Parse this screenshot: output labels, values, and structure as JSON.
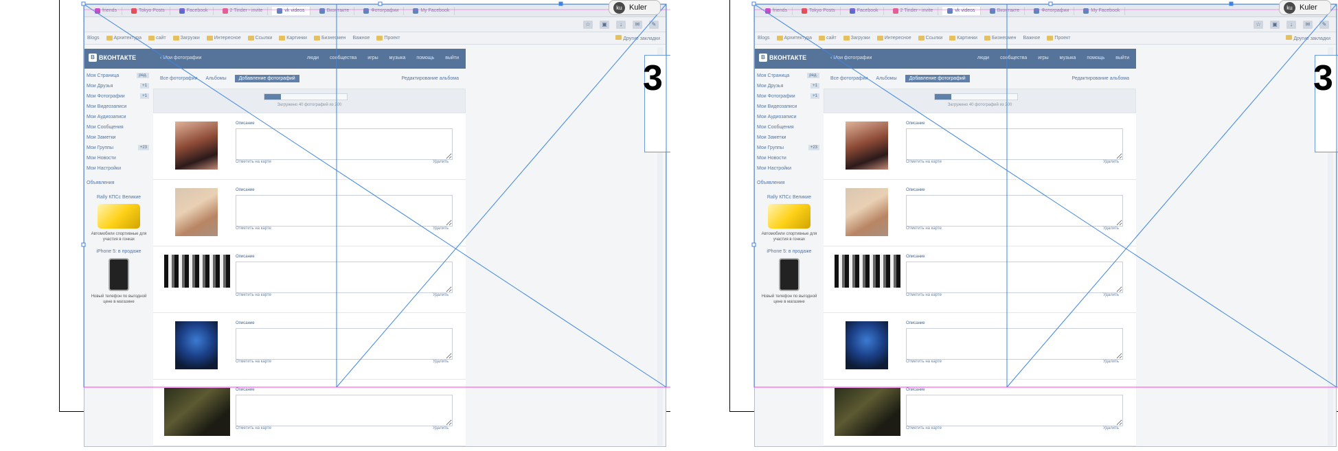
{
  "kuler": {
    "icon": "ku",
    "label": "Kuler"
  },
  "big_number": "3",
  "colors": {
    "vk_blue": "#56739a",
    "guide_blue": "#3d85e0",
    "guide_pink": "#ff3cf0"
  },
  "tabs": [
    {
      "label": "friends",
      "color": "#c44dc4"
    },
    {
      "label": "Tokyo Posts",
      "color": "#e05050"
    },
    {
      "label": "Facebook",
      "color": "#5b6cc8"
    },
    {
      "label": "2 Tinder - invite",
      "color": "#e06090"
    },
    {
      "label": "vk videos",
      "color": "#5a86bd",
      "active": true
    },
    {
      "label": "Вконтакте",
      "color": "#5a86bd"
    },
    {
      "label": "Фотографии",
      "color": "#5a86bd"
    },
    {
      "label": "My Facebook",
      "color": "#5a86bd"
    }
  ],
  "bookmarks": [
    "Blogs",
    "Архитектура",
    "сайт",
    "Загрузки",
    "Интересное",
    "Ссылки",
    "Картинки",
    "Бизнесмен",
    "Важное",
    "Проект"
  ],
  "bookmarks_right": "Другие закладки",
  "vk": {
    "logo_icon": "В",
    "logo": "ВКОНТАКТЕ",
    "crumb": "‹ Мои фотографии",
    "nav": [
      "люди",
      "сообщества",
      "игры",
      "музыка",
      "помощь",
      "выйти"
    ]
  },
  "sidebar": {
    "items": [
      {
        "label": "Моя Страница",
        "badge": "ред."
      },
      {
        "label": "Мои Друзья",
        "badge": "+1"
      },
      {
        "label": "Мои Фотографии",
        "badge": "+1"
      },
      {
        "label": "Мои Видеозаписи",
        "badge": ""
      },
      {
        "label": "Мои Аудиозаписи",
        "badge": ""
      },
      {
        "label": "Мои Сообщения",
        "badge": ""
      },
      {
        "label": "Мои Заметки",
        "badge": ""
      },
      {
        "label": "Мои Группы",
        "badge": "+23"
      },
      {
        "label": "Мои Новости",
        "badge": ""
      },
      {
        "label": "Мои Настройки",
        "badge": ""
      },
      {
        "label": "Объявления",
        "badge": ""
      }
    ],
    "ad1_title": "Rally КПСс Великие",
    "ad1_text": "Автомобили спортивные для участия в гонках",
    "ad2_title": "iPhone 5: в продаже",
    "ad2_text": "Новый телефон по выгодной цене в магазине"
  },
  "content": {
    "subtabs": [
      "Все фотографии",
      "Альбомы",
      "Добавление фотографий"
    ],
    "subtab_right": "Редактирование альбома",
    "upload_progress": 0.2,
    "progress_text": "Загружено 40 фотографий из 200",
    "photos": [
      {
        "caption": "Описание",
        "place": "Отметить на карте",
        "delete": "Удалить"
      },
      {
        "caption": "Описание",
        "place": "Отметить на карте",
        "delete": "Удалить"
      },
      {
        "caption": "Описание",
        "place": "Отметить на карте",
        "delete": "Удалить"
      },
      {
        "caption": "Описание",
        "place": "Отметить на карте",
        "delete": "Удалить"
      },
      {
        "caption": "Описание",
        "place": "Отметить на карте",
        "delete": "Удалить"
      }
    ]
  }
}
